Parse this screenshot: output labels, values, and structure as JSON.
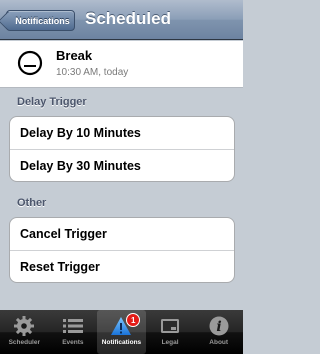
{
  "navbar": {
    "back_label": "Notifications",
    "title": "Scheduled"
  },
  "header": {
    "title": "Break",
    "subtitle": "10:30 AM, today"
  },
  "sections": {
    "delay": {
      "title": "Delay Trigger",
      "items": [
        "Delay By 10 Minutes",
        "Delay By 30 Minutes"
      ]
    },
    "other": {
      "title": "Other",
      "items": [
        "Cancel Trigger",
        "Reset Trigger"
      ]
    }
  },
  "tabbar": {
    "tabs": [
      {
        "label": "Scheduler",
        "icon": "gear-icon"
      },
      {
        "label": "Events",
        "icon": "list-icon"
      },
      {
        "label": "Notifications",
        "icon": "warning-icon",
        "badge": "1",
        "selected": true
      },
      {
        "label": "Legal",
        "icon": "legal-icon"
      },
      {
        "label": "About",
        "icon": "info-icon"
      }
    ]
  },
  "colors": {
    "navbar": "#7f94ae",
    "background": "#c5ccd4",
    "badge": "#e41b17"
  }
}
